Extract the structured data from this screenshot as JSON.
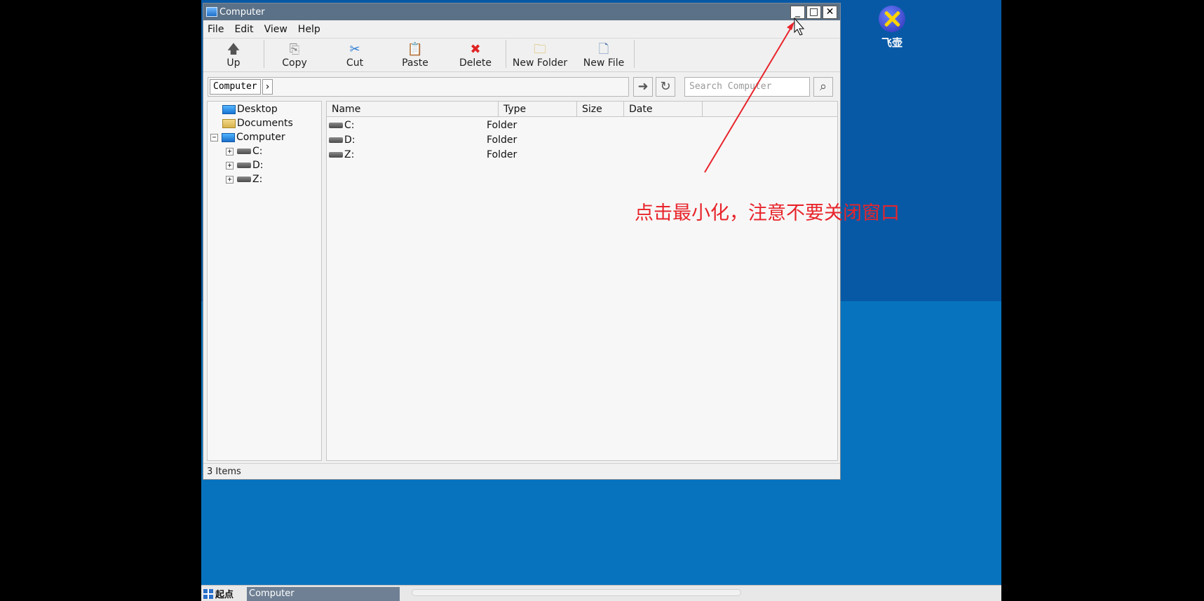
{
  "desktop": {
    "icon_label": "飞壶"
  },
  "window": {
    "title": "Computer",
    "controls": {
      "minimize": "_",
      "maximize": "□",
      "close": "✕"
    }
  },
  "menu": [
    "File",
    "Edit",
    "View",
    "Help"
  ],
  "toolbar": [
    {
      "label": "Up",
      "icon": "up-arrow-icon",
      "glyph": "🡅",
      "color": "#555555"
    },
    {
      "label": "Copy",
      "icon": "copy-icon",
      "glyph": "⎘",
      "color": "#8a8a8a"
    },
    {
      "label": "Cut",
      "icon": "scissors-icon",
      "glyph": "✂",
      "color": "#2b7bd6"
    },
    {
      "label": "Paste",
      "icon": "paste-icon",
      "glyph": "📋",
      "color": "#c79a3a"
    },
    {
      "label": "Delete",
      "icon": "delete-icon",
      "glyph": "✖",
      "color": "#e02424"
    },
    {
      "label": "New Folder",
      "icon": "new-folder-icon",
      "glyph": "🗀",
      "color": "#d8b24a"
    },
    {
      "label": "New File",
      "icon": "new-file-icon",
      "glyph": "🗋",
      "color": "#5a7fb0"
    }
  ],
  "address": {
    "crumb": "Computer",
    "search_placeholder": "Search Computer"
  },
  "tree": [
    {
      "label": "Desktop",
      "icon": "desktop-icon",
      "level": 0
    },
    {
      "label": "Documents",
      "icon": "documents-icon",
      "level": 0
    },
    {
      "label": "Computer",
      "icon": "computer-icon",
      "level": 0,
      "expander": "−"
    },
    {
      "label": "C:",
      "icon": "drive-icon",
      "level": 1,
      "expander": "+"
    },
    {
      "label": "D:",
      "icon": "drive-icon",
      "level": 1,
      "expander": "+"
    },
    {
      "label": "Z:",
      "icon": "drive-icon",
      "level": 1,
      "expander": "+"
    }
  ],
  "columns": [
    "Name",
    "Type",
    "Size",
    "Date"
  ],
  "files": [
    {
      "name": "C:",
      "type": "Folder"
    },
    {
      "name": "D:",
      "type": "Folder"
    },
    {
      "name": "Z:",
      "type": "Folder"
    }
  ],
  "status": "3 Items",
  "taskbar": {
    "start_label": "起点",
    "task_label": "Computer"
  },
  "annotation": {
    "text": "点击最小化，注意不要关闭窗口",
    "color": "#e8242b"
  }
}
